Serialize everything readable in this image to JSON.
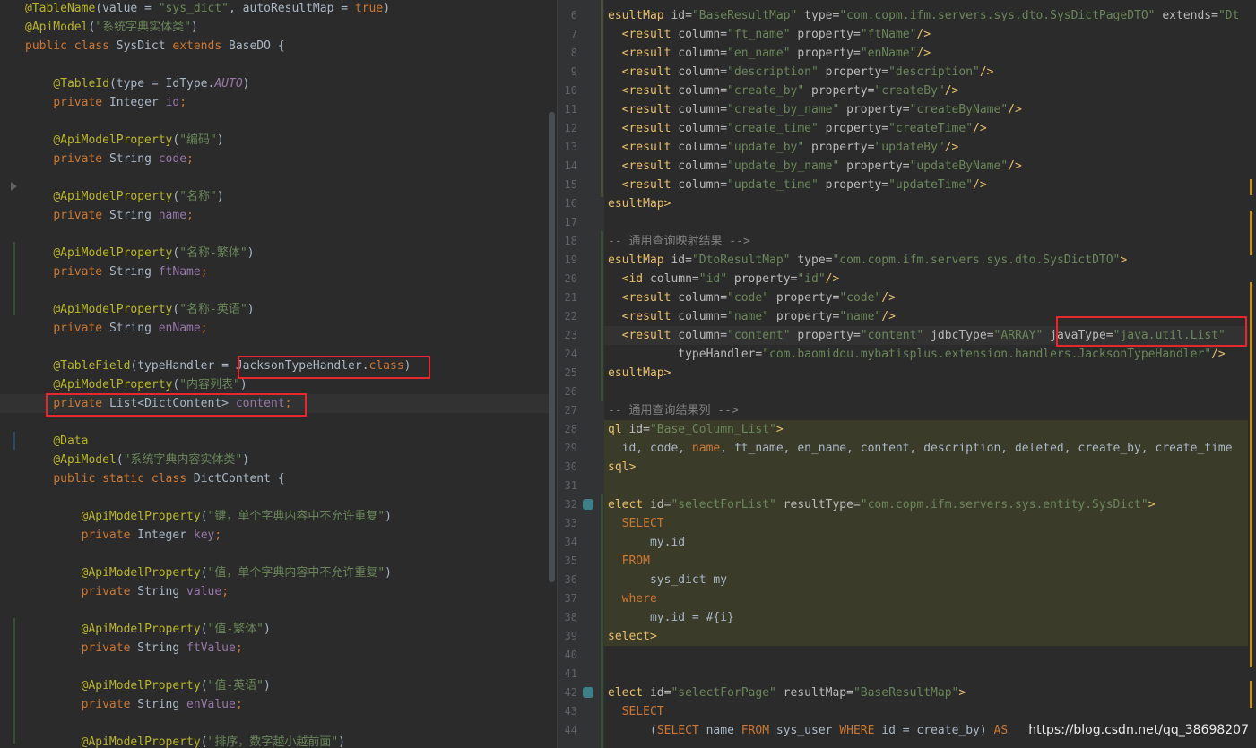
{
  "left": {
    "lines": [
      [
        [
          "a",
          "@TableName"
        ],
        [
          "t",
          "(value = "
        ],
        [
          "s",
          "\"sys_dict\""
        ],
        [
          "t",
          ", autoResultMap = "
        ],
        [
          "k",
          "true"
        ],
        [
          "t",
          ")"
        ]
      ],
      [
        [
          "a",
          "@ApiModel"
        ],
        [
          "t",
          "("
        ],
        [
          "s",
          "\"系统字典实体类\""
        ],
        [
          "t",
          ")"
        ]
      ],
      [
        [
          "k",
          "public class "
        ],
        [
          "t",
          "SysDict "
        ],
        [
          "k",
          "extends "
        ],
        [
          "t",
          "BaseDO {"
        ]
      ],
      [],
      [
        [
          "t",
          "    "
        ],
        [
          "a",
          "@TableId"
        ],
        [
          "t",
          "(type = IdType."
        ],
        [
          "i",
          "AUTO"
        ],
        [
          "t",
          ")"
        ]
      ],
      [
        [
          "t",
          "    "
        ],
        [
          "k",
          "private "
        ],
        [
          "t",
          "Integer "
        ],
        [
          "f",
          "id"
        ],
        [
          "k",
          ";"
        ]
      ],
      [],
      [
        [
          "t",
          "    "
        ],
        [
          "a",
          "@ApiModelProperty"
        ],
        [
          "t",
          "("
        ],
        [
          "s",
          "\"编码\""
        ],
        [
          "t",
          ")"
        ]
      ],
      [
        [
          "t",
          "    "
        ],
        [
          "k",
          "private "
        ],
        [
          "t",
          "String "
        ],
        [
          "f",
          "code"
        ],
        [
          "k",
          ";"
        ]
      ],
      [],
      [
        [
          "t",
          "    "
        ],
        [
          "a",
          "@ApiModelProperty"
        ],
        [
          "t",
          "("
        ],
        [
          "s",
          "\"名称\""
        ],
        [
          "t",
          ")"
        ]
      ],
      [
        [
          "t",
          "    "
        ],
        [
          "k",
          "private "
        ],
        [
          "t",
          "String "
        ],
        [
          "f",
          "name"
        ],
        [
          "k",
          ";"
        ]
      ],
      [],
      [
        [
          "t",
          "    "
        ],
        [
          "a",
          "@ApiModelProperty"
        ],
        [
          "t",
          "("
        ],
        [
          "s",
          "\"名称-繁体\""
        ],
        [
          "t",
          ")"
        ]
      ],
      [
        [
          "t",
          "    "
        ],
        [
          "k",
          "private "
        ],
        [
          "t",
          "String "
        ],
        [
          "f",
          "ftName"
        ],
        [
          "k",
          ";"
        ]
      ],
      [],
      [
        [
          "t",
          "    "
        ],
        [
          "a",
          "@ApiModelProperty"
        ],
        [
          "t",
          "("
        ],
        [
          "s",
          "\"名称-英语\""
        ],
        [
          "t",
          ")"
        ]
      ],
      [
        [
          "t",
          "    "
        ],
        [
          "k",
          "private "
        ],
        [
          "t",
          "String "
        ],
        [
          "f",
          "enName"
        ],
        [
          "k",
          ";"
        ]
      ],
      [],
      [
        [
          "t",
          "    "
        ],
        [
          "a",
          "@TableField"
        ],
        [
          "t",
          "(typeHandler = "
        ],
        [
          "t",
          "JacksonTypeHandler."
        ],
        [
          "k",
          "class"
        ],
        [
          "t",
          ")"
        ]
      ],
      [
        [
          "t",
          "    "
        ],
        [
          "a",
          "@ApiModelProperty"
        ],
        [
          "t",
          "("
        ],
        [
          "s",
          "\"内容列表\""
        ],
        [
          "t",
          ")"
        ]
      ],
      [
        [
          "t",
          "    "
        ],
        [
          "k",
          "private "
        ],
        [
          "t",
          "List<DictContent> "
        ],
        [
          "f",
          "content"
        ],
        [
          "k",
          ";"
        ]
      ],
      [],
      [
        [
          "t",
          "    "
        ],
        [
          "a",
          "@Data"
        ]
      ],
      [
        [
          "t",
          "    "
        ],
        [
          "a",
          "@ApiModel"
        ],
        [
          "t",
          "("
        ],
        [
          "s",
          "\"系统字典内容实体类\""
        ],
        [
          "t",
          ")"
        ]
      ],
      [
        [
          "t",
          "    "
        ],
        [
          "k",
          "public static class "
        ],
        [
          "t",
          "DictContent {"
        ]
      ],
      [],
      [
        [
          "t",
          "        "
        ],
        [
          "a",
          "@ApiModelProperty"
        ],
        [
          "t",
          "("
        ],
        [
          "s",
          "\"键，单个字典内容中不允许重复\""
        ],
        [
          "t",
          ")"
        ]
      ],
      [
        [
          "t",
          "        "
        ],
        [
          "k",
          "private "
        ],
        [
          "t",
          "Integer "
        ],
        [
          "f",
          "key"
        ],
        [
          "k",
          ";"
        ]
      ],
      [],
      [
        [
          "t",
          "        "
        ],
        [
          "a",
          "@ApiModelProperty"
        ],
        [
          "t",
          "("
        ],
        [
          "s",
          "\"值，单个字典内容中不允许重复\""
        ],
        [
          "t",
          ")"
        ]
      ],
      [
        [
          "t",
          "        "
        ],
        [
          "k",
          "private "
        ],
        [
          "t",
          "String "
        ],
        [
          "f",
          "value"
        ],
        [
          "k",
          ";"
        ]
      ],
      [],
      [
        [
          "t",
          "        "
        ],
        [
          "a",
          "@ApiModelProperty"
        ],
        [
          "t",
          "("
        ],
        [
          "s",
          "\"值-繁体\""
        ],
        [
          "t",
          ")"
        ]
      ],
      [
        [
          "t",
          "        "
        ],
        [
          "k",
          "private "
        ],
        [
          "t",
          "String "
        ],
        [
          "f",
          "ftValue"
        ],
        [
          "k",
          ";"
        ]
      ],
      [],
      [
        [
          "t",
          "        "
        ],
        [
          "a",
          "@ApiModelProperty"
        ],
        [
          "t",
          "("
        ],
        [
          "s",
          "\"值-英语\""
        ],
        [
          "t",
          ")"
        ]
      ],
      [
        [
          "t",
          "        "
        ],
        [
          "k",
          "private "
        ],
        [
          "t",
          "String "
        ],
        [
          "f",
          "enValue"
        ],
        [
          "k",
          ";"
        ]
      ],
      [],
      [
        [
          "t",
          "        "
        ],
        [
          "a",
          "@ApiModelProperty"
        ],
        [
          "t",
          "("
        ],
        [
          "s",
          "\"排序，数字越小越前面\""
        ],
        [
          "t",
          ")"
        ]
      ]
    ]
  },
  "right": {
    "line_numbers": [
      "6",
      "7",
      "8",
      "9",
      "10",
      "11",
      "12",
      "13",
      "14",
      "15",
      "16",
      "17",
      "18",
      "19",
      "20",
      "21",
      "22",
      "23",
      "24",
      "25",
      "26",
      "27",
      "28",
      "29",
      "30",
      "31",
      "32",
      "33",
      "34",
      "35",
      "36",
      "37",
      "38",
      "39",
      "40",
      "41",
      "42",
      "43",
      "44"
    ],
    "lines": [
      [
        [
          "tag",
          "esultMap "
        ],
        [
          "at",
          "id="
        ],
        [
          "s",
          "\"BaseResultMap\""
        ],
        [
          "at",
          " type="
        ],
        [
          "s",
          "\"com.copm.ifm.servers.sys.dto.SysDictPageDTO\""
        ],
        [
          "at",
          " extends="
        ],
        [
          "s",
          "\"Dt"
        ]
      ],
      [
        [
          "t",
          "  "
        ],
        [
          "tag",
          "<result "
        ],
        [
          "at",
          "column="
        ],
        [
          "s",
          "\"ft_name\""
        ],
        [
          "at",
          " property="
        ],
        [
          "s",
          "\"ftName\""
        ],
        [
          "tag",
          "/>"
        ]
      ],
      [
        [
          "t",
          "  "
        ],
        [
          "tag",
          "<result "
        ],
        [
          "at",
          "column="
        ],
        [
          "s",
          "\"en_name\""
        ],
        [
          "at",
          " property="
        ],
        [
          "s",
          "\"enName\""
        ],
        [
          "tag",
          "/>"
        ]
      ],
      [
        [
          "t",
          "  "
        ],
        [
          "tag",
          "<result "
        ],
        [
          "at",
          "column="
        ],
        [
          "s",
          "\"description\""
        ],
        [
          "at",
          " property="
        ],
        [
          "s",
          "\"description\""
        ],
        [
          "tag",
          "/>"
        ]
      ],
      [
        [
          "t",
          "  "
        ],
        [
          "tag",
          "<result "
        ],
        [
          "at",
          "column="
        ],
        [
          "s",
          "\"create_by\""
        ],
        [
          "at",
          " property="
        ],
        [
          "s",
          "\"createBy\""
        ],
        [
          "tag",
          "/>"
        ]
      ],
      [
        [
          "t",
          "  "
        ],
        [
          "tag",
          "<result "
        ],
        [
          "at",
          "column="
        ],
        [
          "s",
          "\"create_by_name\""
        ],
        [
          "at",
          " property="
        ],
        [
          "s",
          "\"createByName\""
        ],
        [
          "tag",
          "/>"
        ]
      ],
      [
        [
          "t",
          "  "
        ],
        [
          "tag",
          "<result "
        ],
        [
          "at",
          "column="
        ],
        [
          "s",
          "\"create_time\""
        ],
        [
          "at",
          " property="
        ],
        [
          "s",
          "\"createTime\""
        ],
        [
          "tag",
          "/>"
        ]
      ],
      [
        [
          "t",
          "  "
        ],
        [
          "tag",
          "<result "
        ],
        [
          "at",
          "column="
        ],
        [
          "s",
          "\"update_by\""
        ],
        [
          "at",
          " property="
        ],
        [
          "s",
          "\"updateBy\""
        ],
        [
          "tag",
          "/>"
        ]
      ],
      [
        [
          "t",
          "  "
        ],
        [
          "tag",
          "<result "
        ],
        [
          "at",
          "column="
        ],
        [
          "s",
          "\"update_by_name\""
        ],
        [
          "at",
          " property="
        ],
        [
          "s",
          "\"updateByName\""
        ],
        [
          "tag",
          "/>"
        ]
      ],
      [
        [
          "t",
          "  "
        ],
        [
          "tag",
          "<result "
        ],
        [
          "at",
          "column="
        ],
        [
          "s",
          "\"update_time\""
        ],
        [
          "at",
          " property="
        ],
        [
          "s",
          "\"updateTime\""
        ],
        [
          "tag",
          "/>"
        ]
      ],
      [
        [
          "tag",
          "esultMap>"
        ]
      ],
      [],
      [
        [
          "g",
          "-- 通用查询映射结果 -->"
        ]
      ],
      [
        [
          "tag",
          "esultMap "
        ],
        [
          "at",
          "id="
        ],
        [
          "s",
          "\"DtoResultMap\""
        ],
        [
          "at",
          " type="
        ],
        [
          "s",
          "\"com.copm.ifm.servers.sys.dto.SysDictDTO\""
        ],
        [
          "tag",
          ">"
        ]
      ],
      [
        [
          "t",
          "  "
        ],
        [
          "tag",
          "<id "
        ],
        [
          "at",
          "column="
        ],
        [
          "s",
          "\"id\""
        ],
        [
          "at",
          " property="
        ],
        [
          "s",
          "\"id\""
        ],
        [
          "tag",
          "/>"
        ]
      ],
      [
        [
          "t",
          "  "
        ],
        [
          "tag",
          "<result "
        ],
        [
          "at",
          "column="
        ],
        [
          "s",
          "\"code\""
        ],
        [
          "at",
          " property="
        ],
        [
          "s",
          "\"code\""
        ],
        [
          "tag",
          "/>"
        ]
      ],
      [
        [
          "t",
          "  "
        ],
        [
          "tag",
          "<result "
        ],
        [
          "at",
          "column="
        ],
        [
          "s",
          "\"name\""
        ],
        [
          "at",
          " property="
        ],
        [
          "s",
          "\"name\""
        ],
        [
          "tag",
          "/>"
        ]
      ],
      [
        [
          "t",
          "  "
        ],
        [
          "tag",
          "<result "
        ],
        [
          "at",
          "column="
        ],
        [
          "s",
          "\"content\""
        ],
        [
          "at",
          " property="
        ],
        [
          "s",
          "\"content\""
        ],
        [
          "at",
          " jdbcType="
        ],
        [
          "s",
          "\"ARRAY\""
        ],
        [
          "at",
          " javaType="
        ],
        [
          "s",
          "\"java.util.List\""
        ]
      ],
      [
        [
          "t",
          "          "
        ],
        [
          "at",
          "typeHandler="
        ],
        [
          "s",
          "\"com.baomidou.mybatisplus.extension.handlers.JacksonTypeHandler\""
        ],
        [
          "tag",
          "/>"
        ]
      ],
      [
        [
          "tag",
          "esultMap>"
        ]
      ],
      [],
      [
        [
          "g",
          "-- 通用查询结果列 -->"
        ]
      ],
      [
        [
          "tag",
          "ql "
        ],
        [
          "at",
          "id="
        ],
        [
          "s",
          "\"Base_Column_List\""
        ],
        [
          "tag",
          ">"
        ]
      ],
      [
        [
          "t",
          "  id, code, "
        ],
        [
          "k",
          "name"
        ],
        [
          "t",
          ", ft_name, en_name, content, description, deleted, create_by, create_time"
        ]
      ],
      [
        [
          "tag",
          "sql>"
        ]
      ],
      [],
      [
        [
          "tag",
          "elect "
        ],
        [
          "at",
          "id="
        ],
        [
          "s",
          "\"selectForList\""
        ],
        [
          "at",
          " resultType="
        ],
        [
          "s",
          "\"com.copm.ifm.servers.sys.entity.SysDict\""
        ],
        [
          "tag",
          ">"
        ]
      ],
      [
        [
          "t",
          "  "
        ],
        [
          "k",
          "SELECT"
        ]
      ],
      [
        [
          "t",
          "      my.id"
        ]
      ],
      [
        [
          "t",
          "  "
        ],
        [
          "k",
          "FROM"
        ]
      ],
      [
        [
          "t",
          "      sys_dict my"
        ]
      ],
      [
        [
          "t",
          "  "
        ],
        [
          "k",
          "where"
        ]
      ],
      [
        [
          "t",
          "      my.id = #{i}"
        ]
      ],
      [
        [
          "tag",
          "select>"
        ]
      ],
      [],
      [],
      [
        [
          "tag",
          "elect "
        ],
        [
          "at",
          "id="
        ],
        [
          "s",
          "\"selectForPage\""
        ],
        [
          "at",
          " resultMap="
        ],
        [
          "s",
          "\"BaseResultMap\""
        ],
        [
          "tag",
          ">"
        ]
      ],
      [
        [
          "t",
          "  "
        ],
        [
          "k",
          "SELECT"
        ]
      ],
      [
        [
          "t",
          "      ("
        ],
        [
          "k",
          "SELECT "
        ],
        [
          "t",
          "name "
        ],
        [
          "k",
          "FROM "
        ],
        [
          "t",
          "sys_user "
        ],
        [
          "k",
          "WHERE "
        ],
        [
          "t",
          "id = create_by) "
        ],
        [
          "k",
          "AS"
        ]
      ]
    ]
  },
  "watermark": "https://blog.csdn.net/qq_38698207",
  "colors": {
    "background": "#2b2b2b",
    "keyword": "#cc7832",
    "annotation": "#bbb529",
    "string": "#6a8759",
    "field": "#9876aa",
    "highlight_box": "#e8262e"
  }
}
